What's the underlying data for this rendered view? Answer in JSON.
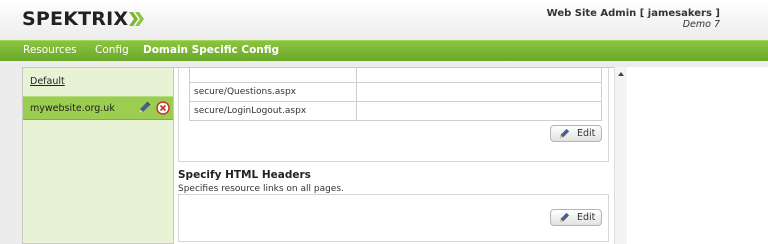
{
  "header": {
    "logo_text": "SPEKTRIX",
    "brand_green": "#7ab532",
    "user_name": "Web Site Admin [ jamesakers ]",
    "environment": "Demo 7"
  },
  "nav": {
    "items": [
      {
        "label": "Resources"
      },
      {
        "label": "Config"
      },
      {
        "label": "Domain Specific Config"
      }
    ],
    "active_index": 2
  },
  "sidebar": {
    "items": [
      {
        "label": "Default"
      },
      {
        "label": "mywebsite.org.uk",
        "selected": true
      }
    ]
  },
  "resources_table": {
    "rows": [
      {
        "path": "secure/Questions.aspx",
        "value": ""
      },
      {
        "path": "secure/LoginLogout.aspx",
        "value": ""
      }
    ],
    "edit_label": "Edit"
  },
  "html_headers": {
    "title": "Specify HTML Headers",
    "description": "Specifies resource links on all pages.",
    "edit_label": "Edit"
  }
}
